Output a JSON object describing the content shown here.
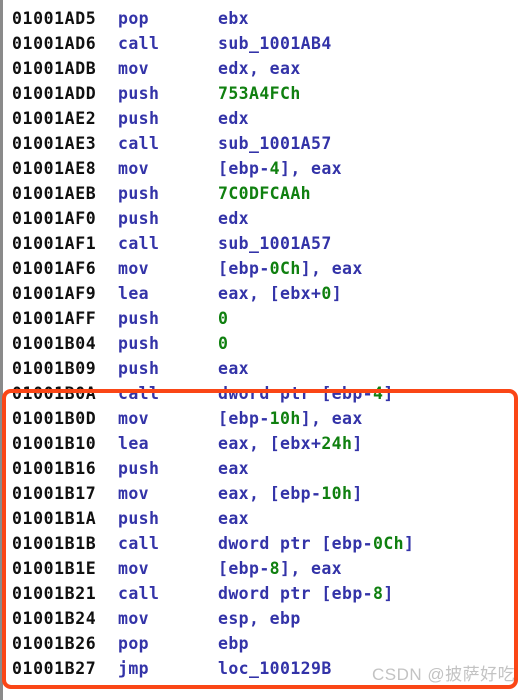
{
  "window": {
    "kind": "disassembly-listing",
    "app": "IDA Pro disassembly view"
  },
  "colors": {
    "background": "#ffffff",
    "address_text": "#101010",
    "mnemonic_text": "#3333a8",
    "register_text": "#3333a8",
    "number_text": "#108010",
    "symbol_text": "#3333a8",
    "highlight_box": "#fa4616",
    "watermark_text": "#c3c3c3",
    "gutter_line": "#8a8a8a"
  },
  "listing": {
    "clipped_top_row": {
      "address": "01001AD5",
      "mnemonic": "",
      "operands_text": ""
    },
    "rows": [
      {
        "address": "01001AD5",
        "mnemonic": "pop",
        "operands_text": "ebx",
        "operand_tokens": [
          {
            "text": "ebx",
            "kind": "reg"
          }
        ],
        "highlighted": false
      },
      {
        "address": "01001AD6",
        "mnemonic": "call",
        "operands_text": "sub_1001AB4",
        "operand_tokens": [
          {
            "text": "sub_1001AB4",
            "kind": "name"
          }
        ],
        "highlighted": false
      },
      {
        "address": "01001ADB",
        "mnemonic": "mov",
        "operands_text": "edx, eax",
        "operand_tokens": [
          {
            "text": "edx, eax",
            "kind": "reg"
          }
        ],
        "highlighted": false
      },
      {
        "address": "01001ADD",
        "mnemonic": "push",
        "operands_text": "753A4FCh",
        "operand_tokens": [
          {
            "text": "753A4FCh",
            "kind": "num"
          }
        ],
        "highlighted": false
      },
      {
        "address": "01001AE2",
        "mnemonic": "push",
        "operands_text": "edx",
        "operand_tokens": [
          {
            "text": "edx",
            "kind": "reg"
          }
        ],
        "highlighted": false
      },
      {
        "address": "01001AE3",
        "mnemonic": "call",
        "operands_text": "sub_1001A57",
        "operand_tokens": [
          {
            "text": "sub_1001A57",
            "kind": "name"
          }
        ],
        "highlighted": false
      },
      {
        "address": "01001AE8",
        "mnemonic": "mov",
        "operands_text": "[ebp-4], eax",
        "operand_tokens": [
          {
            "text": "[ebp-",
            "kind": "reg"
          },
          {
            "text": "4",
            "kind": "num"
          },
          {
            "text": "], eax",
            "kind": "reg"
          }
        ],
        "highlighted": false
      },
      {
        "address": "01001AEB",
        "mnemonic": "push",
        "operands_text": "7C0DFCAAh",
        "operand_tokens": [
          {
            "text": "7C0DFCAAh",
            "kind": "num"
          }
        ],
        "highlighted": false
      },
      {
        "address": "01001AF0",
        "mnemonic": "push",
        "operands_text": "edx",
        "operand_tokens": [
          {
            "text": "edx",
            "kind": "reg"
          }
        ],
        "highlighted": false
      },
      {
        "address": "01001AF1",
        "mnemonic": "call",
        "operands_text": "sub_1001A57",
        "operand_tokens": [
          {
            "text": "sub_1001A57",
            "kind": "name"
          }
        ],
        "highlighted": false
      },
      {
        "address": "01001AF6",
        "mnemonic": "mov",
        "operands_text": "[ebp-0Ch], eax",
        "operand_tokens": [
          {
            "text": "[ebp-",
            "kind": "reg"
          },
          {
            "text": "0Ch",
            "kind": "num"
          },
          {
            "text": "], eax",
            "kind": "reg"
          }
        ],
        "highlighted": false
      },
      {
        "address": "01001AF9",
        "mnemonic": "lea",
        "operands_text": "eax, [ebx+0]",
        "operand_tokens": [
          {
            "text": "eax, [ebx+",
            "kind": "reg"
          },
          {
            "text": "0",
            "kind": "num"
          },
          {
            "text": "]",
            "kind": "reg"
          }
        ],
        "highlighted": false
      },
      {
        "address": "01001AFF",
        "mnemonic": "push",
        "operands_text": "0",
        "operand_tokens": [
          {
            "text": "0",
            "kind": "num"
          }
        ],
        "highlighted": false
      },
      {
        "address": "01001B04",
        "mnemonic": "push",
        "operands_text": "0",
        "operand_tokens": [
          {
            "text": "0",
            "kind": "num"
          }
        ],
        "highlighted": false
      },
      {
        "address": "01001B09",
        "mnemonic": "push",
        "operands_text": "eax",
        "operand_tokens": [
          {
            "text": "eax",
            "kind": "reg"
          }
        ],
        "highlighted": false
      },
      {
        "address": "01001B0A",
        "mnemonic": "call",
        "operands_text": "dword ptr [ebp-4]",
        "operand_tokens": [
          {
            "text": "dword ptr [ebp-",
            "kind": "reg"
          },
          {
            "text": "4",
            "kind": "num"
          },
          {
            "text": "]",
            "kind": "reg"
          }
        ],
        "highlighted": true
      },
      {
        "address": "01001B0D",
        "mnemonic": "mov",
        "operands_text": "[ebp-10h], eax",
        "operand_tokens": [
          {
            "text": "[ebp-",
            "kind": "reg"
          },
          {
            "text": "10h",
            "kind": "num"
          },
          {
            "text": "], eax",
            "kind": "reg"
          }
        ],
        "highlighted": true
      },
      {
        "address": "01001B10",
        "mnemonic": "lea",
        "operands_text": "eax, [ebx+24h]",
        "operand_tokens": [
          {
            "text": "eax, [ebx+",
            "kind": "reg"
          },
          {
            "text": "24h",
            "kind": "num"
          },
          {
            "text": "]",
            "kind": "reg"
          }
        ],
        "highlighted": true
      },
      {
        "address": "01001B16",
        "mnemonic": "push",
        "operands_text": "eax",
        "operand_tokens": [
          {
            "text": "eax",
            "kind": "reg"
          }
        ],
        "highlighted": true
      },
      {
        "address": "01001B17",
        "mnemonic": "mov",
        "operands_text": "eax, [ebp-10h]",
        "operand_tokens": [
          {
            "text": "eax, [ebp-",
            "kind": "reg"
          },
          {
            "text": "10h",
            "kind": "num"
          },
          {
            "text": "]",
            "kind": "reg"
          }
        ],
        "highlighted": true
      },
      {
        "address": "01001B1A",
        "mnemonic": "push",
        "operands_text": "eax",
        "operand_tokens": [
          {
            "text": "eax",
            "kind": "reg"
          }
        ],
        "highlighted": true
      },
      {
        "address": "01001B1B",
        "mnemonic": "call",
        "operands_text": "dword ptr [ebp-0Ch]",
        "operand_tokens": [
          {
            "text": "dword ptr [ebp-",
            "kind": "reg"
          },
          {
            "text": "0Ch",
            "kind": "num"
          },
          {
            "text": "]",
            "kind": "reg"
          }
        ],
        "highlighted": true
      },
      {
        "address": "01001B1E",
        "mnemonic": "mov",
        "operands_text": "[ebp-8], eax",
        "operand_tokens": [
          {
            "text": "[ebp-",
            "kind": "reg"
          },
          {
            "text": "8",
            "kind": "num"
          },
          {
            "text": "], eax",
            "kind": "reg"
          }
        ],
        "highlighted": true
      },
      {
        "address": "01001B21",
        "mnemonic": "call",
        "operands_text": "dword ptr [ebp-8]",
        "operand_tokens": [
          {
            "text": "dword ptr [ebp-",
            "kind": "reg"
          },
          {
            "text": "8",
            "kind": "num"
          },
          {
            "text": "]",
            "kind": "reg"
          }
        ],
        "highlighted": true
      },
      {
        "address": "01001B24",
        "mnemonic": "mov",
        "operands_text": "esp, ebp",
        "operand_tokens": [
          {
            "text": "esp, ebp",
            "kind": "reg"
          }
        ],
        "highlighted": true
      },
      {
        "address": "01001B26",
        "mnemonic": "pop",
        "operands_text": "ebp",
        "operand_tokens": [
          {
            "text": "ebp",
            "kind": "reg"
          }
        ],
        "highlighted": true
      },
      {
        "address": "01001B27",
        "mnemonic": "jmp",
        "operands_text": "loc_100129B",
        "operand_tokens": [
          {
            "text": "loc_100129B",
            "kind": "name"
          }
        ],
        "highlighted": true
      }
    ]
  },
  "watermark": {
    "text": "CSDN @披萨好吃"
  }
}
